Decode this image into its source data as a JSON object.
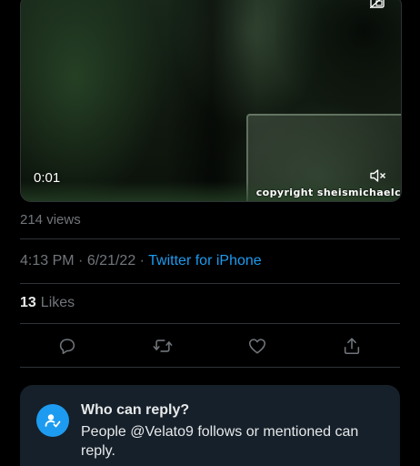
{
  "video": {
    "elapsed": "0:01",
    "watermark": "copyright  sheismichaelc",
    "mute_icon": "speaker-muted-icon",
    "pip_icon": "picture-in-picture-off-icon"
  },
  "tweet": {
    "views": "214 views",
    "time": "4:13 PM",
    "separator": "·",
    "date": "6/21/22",
    "source": "Twitter for iPhone",
    "likes_count": "13",
    "likes_label": "Likes"
  },
  "actions": [
    {
      "icon": "reply-icon"
    },
    {
      "icon": "retweet-icon"
    },
    {
      "icon": "like-heart-icon"
    },
    {
      "icon": "share-icon"
    }
  ],
  "who_can_reply": {
    "title": "Who can reply?",
    "description": "People @Velato9 follows or mentioned can reply.",
    "badge_icon": "user-check-icon"
  },
  "colors": {
    "background": "#000000",
    "accent": "#1d9bf0",
    "muted_text": "#71767b",
    "card_background": "#16202a",
    "divider": "#2f3336"
  }
}
